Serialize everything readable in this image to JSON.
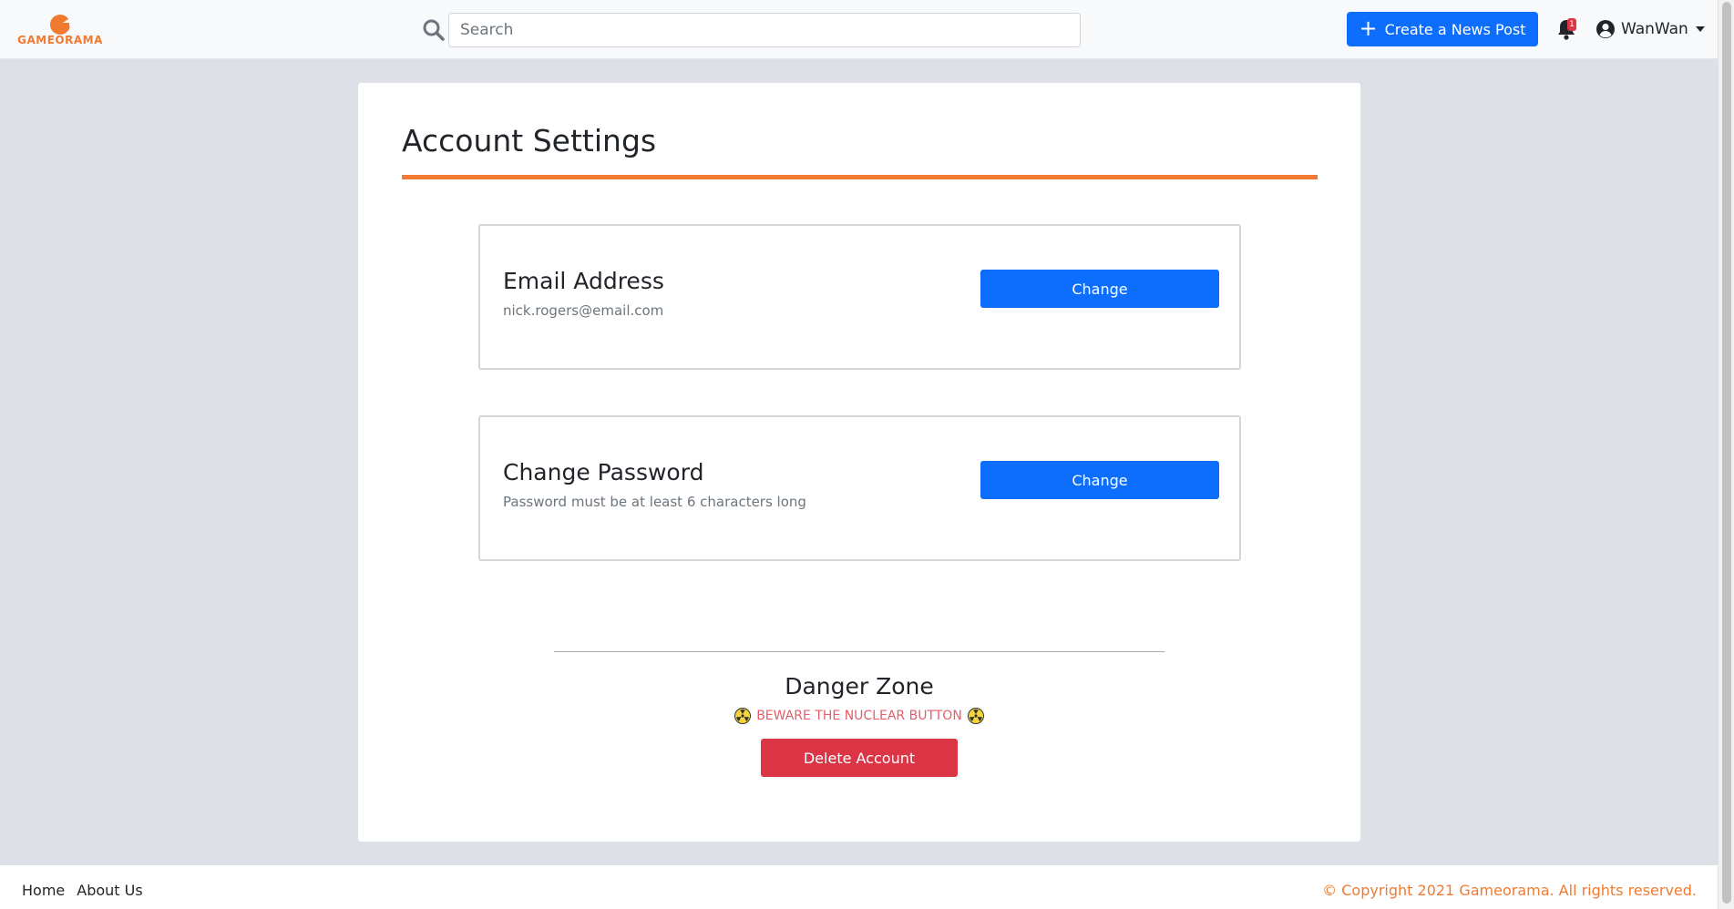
{
  "brand": {
    "name": "GAMEORAMA",
    "accent_color": "#f07a30"
  },
  "header": {
    "search_placeholder": "Search",
    "search_icon": "search-icon",
    "create_post_label": "Create a News Post",
    "notification_count": "1",
    "username": "WanWan"
  },
  "page": {
    "title": "Account Settings"
  },
  "settings": [
    {
      "heading": "Email Address",
      "detail": "nick.rogers@email.com",
      "button_label": "Change"
    },
    {
      "heading": "Change Password",
      "detail": "Password must be at least 6 characters long",
      "button_label": "Change"
    }
  ],
  "danger_zone": {
    "title": "Danger Zone",
    "warning": "BEWARE THE NUCLEAR BUTTON",
    "button_label": "Delete Account",
    "button_color": "#dc3545"
  },
  "footer": {
    "links": [
      "Home",
      "About Us"
    ],
    "copyright": "© Copyright 2021 Gameorama. All rights reserved."
  },
  "colors": {
    "primary": "#0d6efd",
    "danger": "#dc3545",
    "background": "#dde1e7"
  }
}
